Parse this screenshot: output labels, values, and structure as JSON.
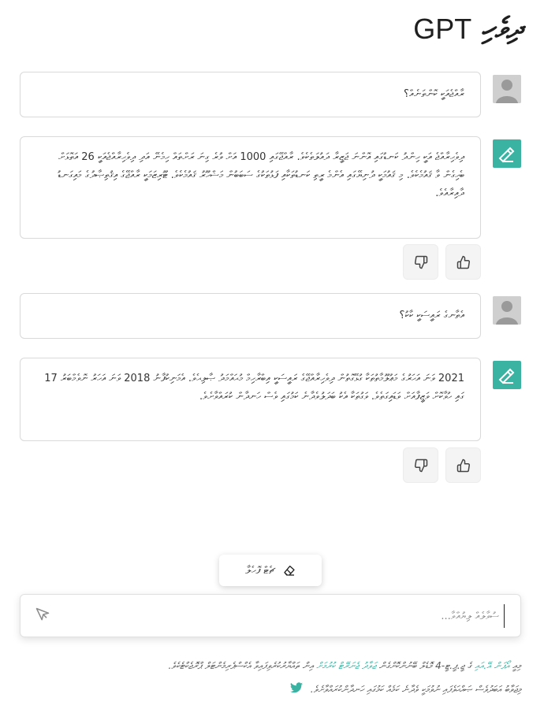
{
  "header": {
    "title_latin": "GPT",
    "title_dhivehi": "ދިވެހި"
  },
  "messages": [
    {
      "role": "user",
      "text": "ރާއްޖެއަކީ ކޮންތަނެއް؟"
    },
    {
      "role": "assistant",
      "text": "ދިވެހިރާއްޖެ އަކީ ހިންދު ކަނޑުގައި އޮންނަ ޖަޒީރާ ދައުލަތެކެވެ. ރާއްޖޭގައި 1000 އަށް ވުރެ ގިނަ ރަށްތައް ހިމެނޭ އަދި ދިވެހިރާއްޖެއަކީ 26 އަތޮޅަށް ބެހިގެން ވާ ޤައުމެކެވެ. މި ޤައުމަކީ ދުނިޔޭގައި އެންމެ ރީތި ކަނޑުތަކާއި ފަޅުތަކުގެ ސަބަބުން މަޝްހޫރު ޤައުމެކެވެ. ޓޫރިޒަމަކީ ރާއްޖޭގެ އިޤުތިޞާދުގެ މައިގަނޑު ދާއިރާއެވެ."
    },
    {
      "role": "user",
      "text": "އެތާނގެ ރައީސަކީ ކާކު؟"
    },
    {
      "role": "assistant",
      "text": "2021 ވަނަ އަހަރުގެ މަޢުލޫމާތުތަކާ ގުޅޭގޮތުން ދިވެހިރާއްޖޭގެ ރައީސަކީ އިބްރާހިމް މުޙައްމަދު ޞާލިޙެވެ. އެމަނިކުފާނު 2018 ވަނަ އަހަރު ނޮވެމްބަރު 17 ގައި ހުވާކޮށް ވަޒީފާއަށް ވަޑައިގަތެވެ. ވަގުތަކާ އެކު ބަދަލުވެދާނެ ކަމުގައި ވެސް ހަނދާން ކުރައްވާށެވެ."
    }
  ],
  "feedback": {
    "dislike_icon": "thumbs-down-icon",
    "like_icon": "thumbs-up-icon"
  },
  "controls": {
    "clear_label": "ޗެޓް ފޮހެލާ",
    "clear_icon": "eraser-icon"
  },
  "input": {
    "placeholder": "ސުވާލެއް ލިޔުއްވާ...",
    "value": "",
    "send_icon": "send-icon"
  },
  "footer": {
    "line1_prefix": "މިއީ",
    "line1_link1": "އޯޕަން އޭ.އައި",
    "line1_mid": "ގެ ޖީ.ޕީ.ޓީ-4 މޮޑެލް ބޭނުންކޮށްގެން",
    "line1_link2": "ޖަވާދު ޖެނަރޭޓް ކުރުމަށް",
    "line1_suffix": "އިން ތައްޔާރުކުރެވިފައިވާ އެކްސްޕެރިމެންޓަލް ޕްރޮޖެކްޓެކެވެ.",
    "line2": "މިޖަވާބު އަބަދުވެސް ޞައްޙަވެފައި ނުވުމަކީ ވެދާނެ ކަމެއް ކަމުގައި ހަނދާންކުރައްވާށެވެ.",
    "twitter_icon": "twitter-icon"
  },
  "colors": {
    "accent": "#3bb3a3",
    "border": "#d9d9d9"
  }
}
